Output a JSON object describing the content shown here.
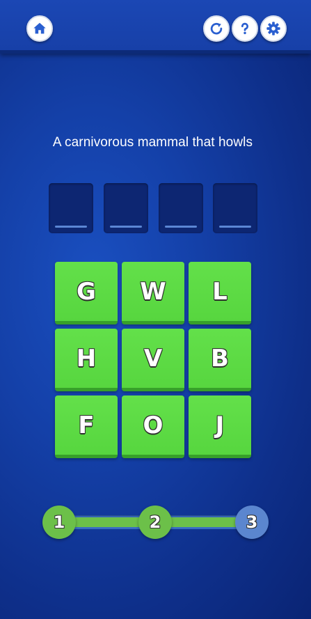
{
  "header": {
    "buttons": [
      {
        "icon": "home-icon"
      },
      {
        "icon": "restart-icon"
      },
      {
        "icon": "help-icon"
      },
      {
        "icon": "settings-icon"
      }
    ]
  },
  "puzzle": {
    "clue": "A carnivorous mammal that howls",
    "answer_slots": [
      "",
      "",
      "",
      ""
    ],
    "letters": [
      [
        "G",
        "W",
        "L"
      ],
      [
        "H",
        "V",
        "B"
      ],
      [
        "F",
        "O",
        "J"
      ]
    ]
  },
  "progress": {
    "steps": [
      "1",
      "2",
      "3"
    ],
    "completed": 2,
    "current": 3
  },
  "colors": {
    "background": "#1440a8",
    "tile": "#57d63f",
    "tile_shadow": "#37a02a",
    "slot": "#0d2672",
    "step_done": "#6cc049",
    "step_current": "#5b86cf"
  }
}
